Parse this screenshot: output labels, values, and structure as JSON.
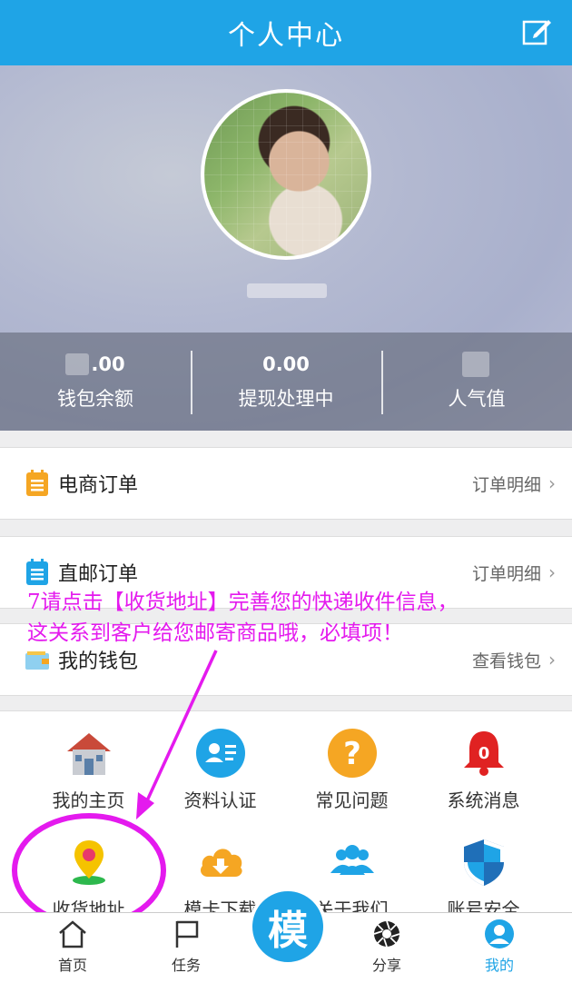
{
  "header": {
    "title": "个人中心",
    "edit_icon": "edit-icon"
  },
  "profile": {
    "avatar": "avatar",
    "username": ""
  },
  "stats": [
    {
      "value": ".00",
      "label": "钱包余额"
    },
    {
      "value": "0.00",
      "label": "提现处理中"
    },
    {
      "value": "",
      "label": "人气值"
    }
  ],
  "rows": {
    "ecommerce": {
      "label": "电商订单",
      "link": "订单明细"
    },
    "direct_mail": {
      "label": "直邮订单",
      "link": "订单明细"
    },
    "wallet": {
      "label": "我的钱包",
      "link": "查看钱包"
    }
  },
  "grid": [
    {
      "label": "我的主页",
      "icon": "house-icon"
    },
    {
      "label": "资料认证",
      "icon": "id-card-icon"
    },
    {
      "label": "常见问题",
      "icon": "question-icon"
    },
    {
      "label": "系统消息",
      "icon": "bell-icon",
      "badge": "0"
    },
    {
      "label": "收货地址",
      "icon": "location-pin-icon"
    },
    {
      "label": "模卡下载",
      "icon": "cloud-download-icon"
    },
    {
      "label": "关于我们",
      "icon": "people-icon"
    },
    {
      "label": "账号安全",
      "icon": "shield-icon"
    }
  ],
  "tabbar": {
    "home": "首页",
    "tasks": "任务",
    "center": "模",
    "share": "分享",
    "mine": "我的"
  },
  "annotation": {
    "line1": "7请点击【收货地址】完善您的快递收件信息，",
    "line2": "这关系到客户给您邮寄商品哦，必填项！"
  },
  "colors": {
    "accent": "#1fa4e6",
    "annotation": "#e41aee"
  }
}
